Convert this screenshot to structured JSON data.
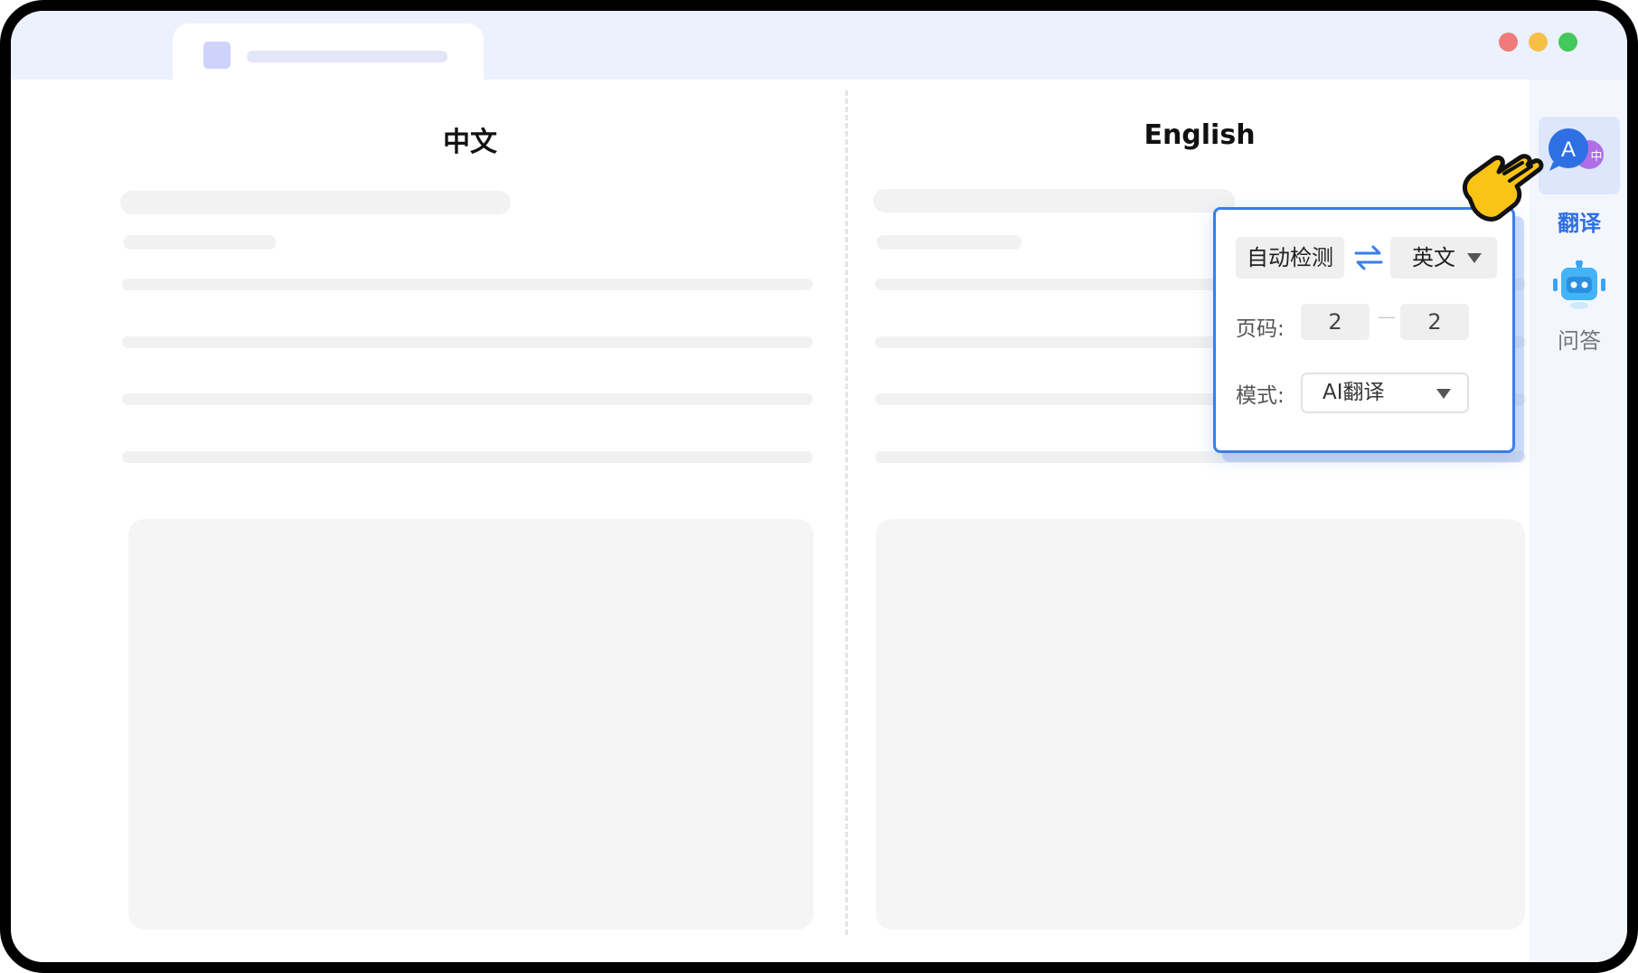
{
  "window": {
    "controls": [
      {
        "name": "close",
        "color": "#ef7b7b"
      },
      {
        "name": "minimize",
        "color": "#f7bf45"
      },
      {
        "name": "maximize",
        "color": "#43c85a"
      }
    ]
  },
  "columns": {
    "source_title": "中文",
    "target_title": "English"
  },
  "sidebar": {
    "items": [
      {
        "label": "翻译",
        "icon": "translate-icon",
        "active": true,
        "color": "#2f6fe4"
      },
      {
        "label": "问答",
        "icon": "robot-icon",
        "active": false,
        "color": "#777777"
      }
    ]
  },
  "popover": {
    "source_lang": "自动检测",
    "swap_icon": "swap-arrows-icon",
    "target_lang": "英文",
    "page_label": "页码:",
    "page_from": "2",
    "page_to": "2",
    "page_separator": "—",
    "mode_label": "模式:",
    "mode_value": "AI翻译"
  },
  "colors": {
    "accent": "#3a7ee8",
    "hand": "#f9c416"
  }
}
